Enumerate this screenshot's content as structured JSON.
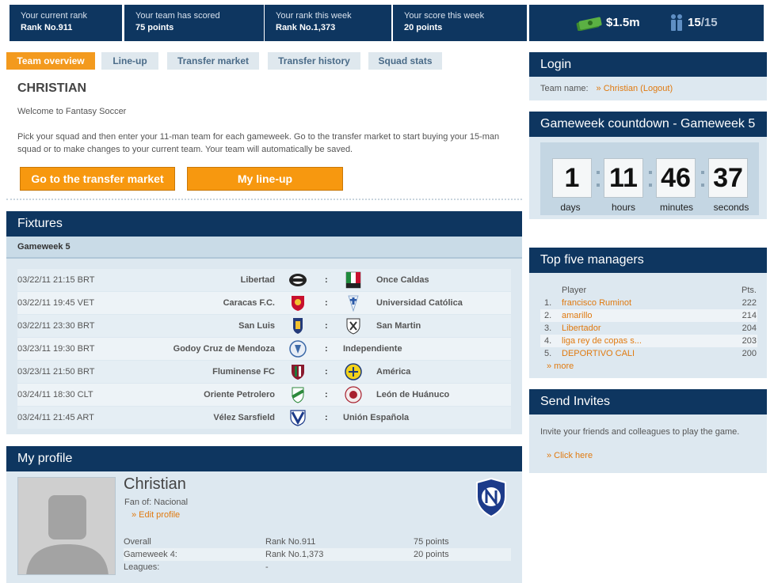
{
  "stats": {
    "current_rank_label": "Your current rank",
    "current_rank_value": "Rank No.911",
    "scored_label": "Your team has scored",
    "scored_value": "75 points",
    "week_rank_label": "Your rank this week",
    "week_rank_value": "Rank No.1,373",
    "week_score_label": "Your score this week",
    "week_score_value": "20 points",
    "budget": "$1.5m",
    "squad_count": "15",
    "squad_total": "/15"
  },
  "tabs": [
    "Team overview",
    "Line-up",
    "Transfer market",
    "Transfer history",
    "Squad stats"
  ],
  "overview": {
    "team_name": "CHRISTIAN",
    "welcome": "Welcome to Fantasy Soccer",
    "intro": "Pick your squad and then enter your 11-man team for each gameweek. Go to the transfer market to start buying your 15-man squad or to make changes to your current team. Your team will automatically be saved.",
    "transfer_button": "Go to the transfer market",
    "lineup_button": "My line-up"
  },
  "fixtures": {
    "title": "Fixtures",
    "gameweek": "Gameweek 5",
    "separator": ":",
    "rows": [
      {
        "date": "03/22/11 21:15 BRT",
        "home": "Libertad",
        "away": "Once Caldas"
      },
      {
        "date": "03/22/11 19:45 VET",
        "home": "Caracas F.C.",
        "away": "Universidad Católica"
      },
      {
        "date": "03/22/11 23:30 BRT",
        "home": "San Luis",
        "away": "San Martin"
      },
      {
        "date": "03/23/11 19:30 BRT",
        "home": "Godoy Cruz de Mendoza",
        "away": "Independiente"
      },
      {
        "date": "03/23/11 21:50 BRT",
        "home": "Fluminense FC",
        "away": "América"
      },
      {
        "date": "03/24/11 18:30 CLT",
        "home": "Oriente Petrolero",
        "away": "León de Huánuco"
      },
      {
        "date": "03/24/11 21:45 ART",
        "home": "Vélez Sarsfield",
        "away": "Unión Española"
      }
    ]
  },
  "profile": {
    "title": "My profile",
    "name": "Christian",
    "fan_of": "Fan of: Nacional",
    "edit": "» Edit profile",
    "overall_label": "Overall",
    "overall_rank": "Rank No.911",
    "overall_points": "75 points",
    "gw_label": "Gameweek 4:",
    "gw_rank": "Rank No.1,373",
    "gw_points": "20 points",
    "leagues_label": "Leagues:",
    "leagues_value": "-"
  },
  "login": {
    "title": "Login",
    "team_label": "Team name:",
    "team_value": "» Christian (Logout)"
  },
  "countdown": {
    "title": "Gameweek countdown - Gameweek 5",
    "days": "1",
    "hours": "11",
    "minutes": "46",
    "seconds": "37",
    "days_label": "days",
    "hours_label": "hours",
    "minutes_label": "minutes",
    "seconds_label": "seconds"
  },
  "managers": {
    "title": "Top five managers",
    "player_header": "Player",
    "pts_header": "Pts.",
    "rows": [
      {
        "rank": "1.",
        "name": "francisco Ruminot",
        "pts": "222"
      },
      {
        "rank": "2.",
        "name": "amarillo",
        "pts": "214"
      },
      {
        "rank": "3.",
        "name": "Libertador",
        "pts": "204"
      },
      {
        "rank": "4.",
        "name": "liga rey de copas s...",
        "pts": "203"
      },
      {
        "rank": "5.",
        "name": "DEPORTIVO CALI",
        "pts": "200"
      }
    ],
    "more": "» more"
  },
  "invites": {
    "title": "Send Invites",
    "text": "Invite your friends and colleagues to play the game.",
    "link": "» Click here"
  },
  "colors": {
    "navy": "#0e3660",
    "accent_orange": "#f7980f",
    "link_orange": "#e07a10",
    "panel_blue": "#dde8f0"
  }
}
